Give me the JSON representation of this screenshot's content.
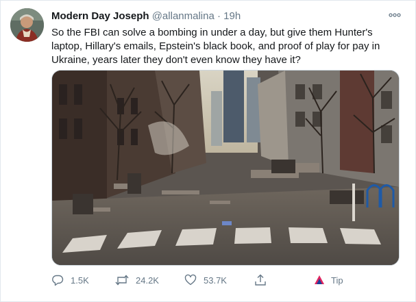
{
  "author": {
    "display_name": "Modern Day Joseph",
    "handle": "@allanmalina",
    "separator": "·",
    "time": "19h"
  },
  "tweet": {
    "text": "So the FBI can solve a bombing in under a day, but give them Hunter's laptop, Hillary's emails, Epstein's black book, and proof of play for pay in Ukraine, years later they don't even know they have it?"
  },
  "actions": {
    "reply_count": "1.5K",
    "retweet_count": "24.2K",
    "like_count": "53.7K",
    "tip_label": "Tip"
  },
  "icons": {
    "more": "more-horizontal-icon",
    "reply": "reply-icon",
    "retweet": "retweet-icon",
    "like": "heart-icon",
    "share": "share-icon",
    "tip": "tip-icon"
  },
  "colors": {
    "text_primary": "#14171a",
    "text_secondary": "#657786",
    "border": "#e1e8ed",
    "tip_red": "#e0245e",
    "tip_blue": "#1d3f99"
  }
}
